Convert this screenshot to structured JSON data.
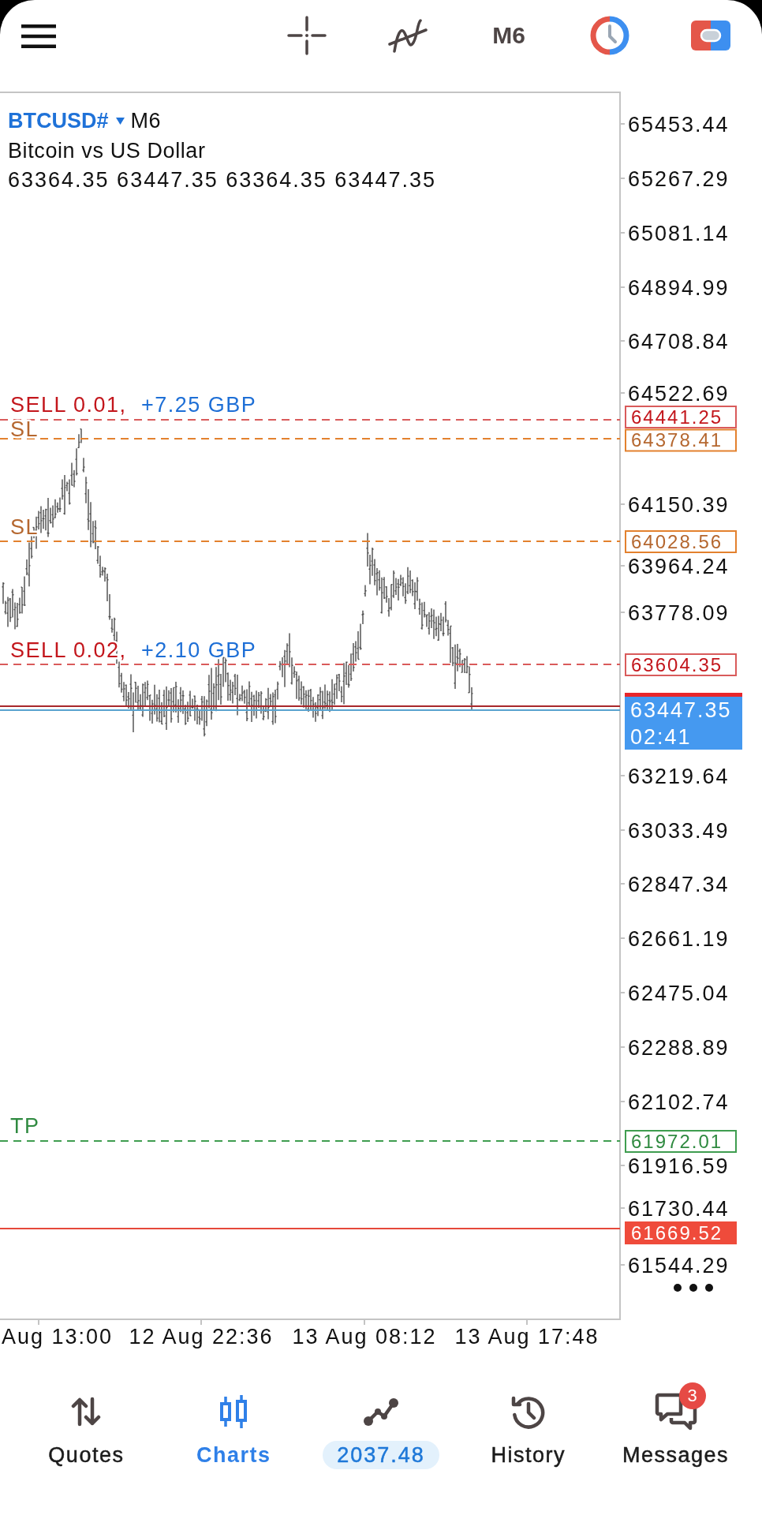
{
  "top_bar": {
    "timeframe": "M6"
  },
  "chart": {
    "symbol": "BTCUSD#",
    "timeframe": "M6",
    "description": "Bitcoin vs US Dollar",
    "ohlc": "63364.35 63447.35 63364.35 63447.35",
    "price_axis": [
      "65453.44",
      "65267.29",
      "65081.14",
      "64894.99",
      "64708.84",
      "64522.69",
      "64150.39",
      "63964.24",
      "63778.09",
      "63219.64",
      "63033.49",
      "62847.34",
      "62661.19",
      "62475.04",
      "62288.89",
      "62102.74",
      "61916.59",
      "61730.44",
      "61544.29"
    ],
    "time_axis": [
      "Aug 13:00",
      "12 Aug 22:36",
      "13 Aug 08:12",
      "13 Aug 17:48"
    ],
    "levels": [
      {
        "kind": "sell",
        "label": "SELL 0.01,",
        "profit": "+7.25 GBP",
        "price": "64441.25"
      },
      {
        "kind": "sl",
        "label": "SL",
        "price": "64378.41"
      },
      {
        "kind": "sl",
        "label": "SL",
        "price": "64028.56"
      },
      {
        "kind": "sell",
        "label": "SELL 0.02,",
        "profit": "+2.10 GBP",
        "price": "63604.35"
      },
      {
        "kind": "bid",
        "price": "63447.35",
        "timer": "02:41"
      },
      {
        "kind": "tp",
        "label": "TP",
        "price": "61972.01"
      },
      {
        "kind": "level",
        "price": "61669.52"
      }
    ]
  },
  "nav": [
    {
      "kind": "tab",
      "label": "Quotes",
      "selected": false
    },
    {
      "kind": "tab",
      "label": "Charts",
      "selected": true
    },
    {
      "kind": "balance",
      "label": "2037.48",
      "selected": false
    },
    {
      "kind": "tab",
      "label": "History",
      "selected": false
    },
    {
      "kind": "tab",
      "label": "Messages",
      "selected": false,
      "badge": "3"
    }
  ]
}
